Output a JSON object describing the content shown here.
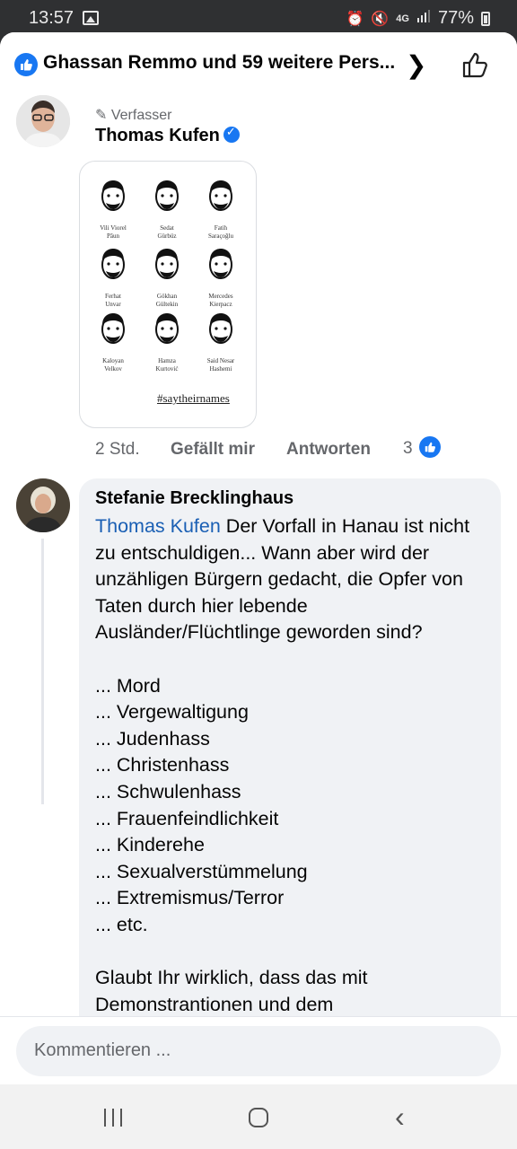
{
  "status_bar": {
    "time": "13:57",
    "battery": "77%",
    "network": "4G",
    "icons": [
      "gallery-icon",
      "alarm-icon",
      "mute-icon",
      "signal-icon",
      "battery-icon"
    ]
  },
  "header": {
    "reactors": "Ghassan Remmo und 59 weitere Pers...",
    "icons": [
      "like-badge-icon",
      "chevron-right-icon",
      "thumbs-up-icon"
    ]
  },
  "post_comment": {
    "author_tag": "Verfasser",
    "author_name": "Thomas Kufen",
    "image": {
      "names": [
        [
          "Vili Viorel",
          "Păun"
        ],
        [
          "Sedat",
          "Gürbüz"
        ],
        [
          "Fatih",
          "Saraçoğlu"
        ],
        [
          "Ferhat",
          "Unvar"
        ],
        [
          "Gökhan",
          "Gültekin"
        ],
        [
          "Mercedes",
          "Kierpacz"
        ],
        [
          "Kaloyan",
          "Velkov"
        ],
        [
          "Hamza",
          "Kurtović"
        ],
        [
          "Said Nesar",
          "Hashemi"
        ]
      ],
      "hashtag": "#saytheirnames"
    },
    "time": "2 Std.",
    "like_label": "Gefällt mir",
    "reply_label": "Antworten",
    "like_count": "3"
  },
  "reply": {
    "author": "Stefanie Brecklinghaus",
    "mention": "Thomas Kufen",
    "text": " Der Vorfall in Hanau ist nicht zu entschuldigen... Wann aber wird der unzähligen Bürgern gedacht, die Opfer von Taten durch hier lebende Ausländer/Flüchtlinge geworden sind?\n\n... Mord\n... Vergewaltigung\n... Judenhass\n... Christenhass\n... Schwulenhass\n... Frauenfeindlichkeit\n... Kinderehe\n... Sexualverstümmelung\n... Extremismus/Terror\n... etc.\n\nGlaubt Ihr wirklich, dass das mit Demonstrantionen und dem"
  },
  "composer": {
    "placeholder": "Kommentieren ..."
  },
  "colors": {
    "accent": "#1877f2",
    "mention": "#1a5fb4",
    "bubble": "#f0f2f5"
  }
}
